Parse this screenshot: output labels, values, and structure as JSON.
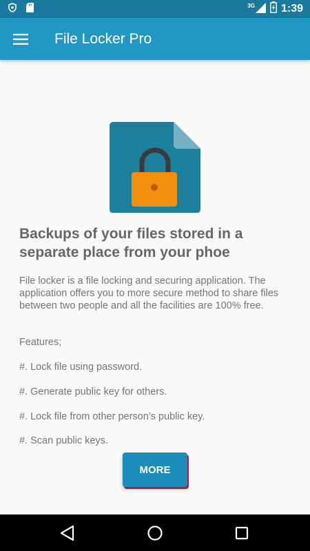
{
  "status_bar": {
    "time": "1:39",
    "network_label": "3G",
    "icons": [
      "shield-icon",
      "sd-card-icon",
      "signal-icon",
      "battery-icon"
    ]
  },
  "app_bar": {
    "title": "File Locker Pro",
    "menu_icon": "hamburger-menu-icon"
  },
  "main": {
    "hero_icon": "locked-file-icon",
    "headline": "Backups of your files stored in a separate place from your phoe",
    "description": "File locker is a file locking and securing application. The application offers you to more secure method to share files between two people and all the facilities are 100% free.",
    "features_heading": "Features;",
    "features": [
      "#. Lock file using password.",
      "#. Generate public key for others.",
      "#. Lock file from other person’s public key.",
      "#. Scan public keys."
    ],
    "more_button": "MORE"
  },
  "nav_bar": {
    "icons": [
      "back-icon",
      "home-icon",
      "recents-icon"
    ]
  },
  "colors": {
    "status_bar": "#1a7a9e",
    "app_bar": "#2197c3",
    "file_icon": "#1f7f9c",
    "lock": "#f5900e",
    "button": "#1a8db8",
    "button_shadow": "#9d2740"
  }
}
